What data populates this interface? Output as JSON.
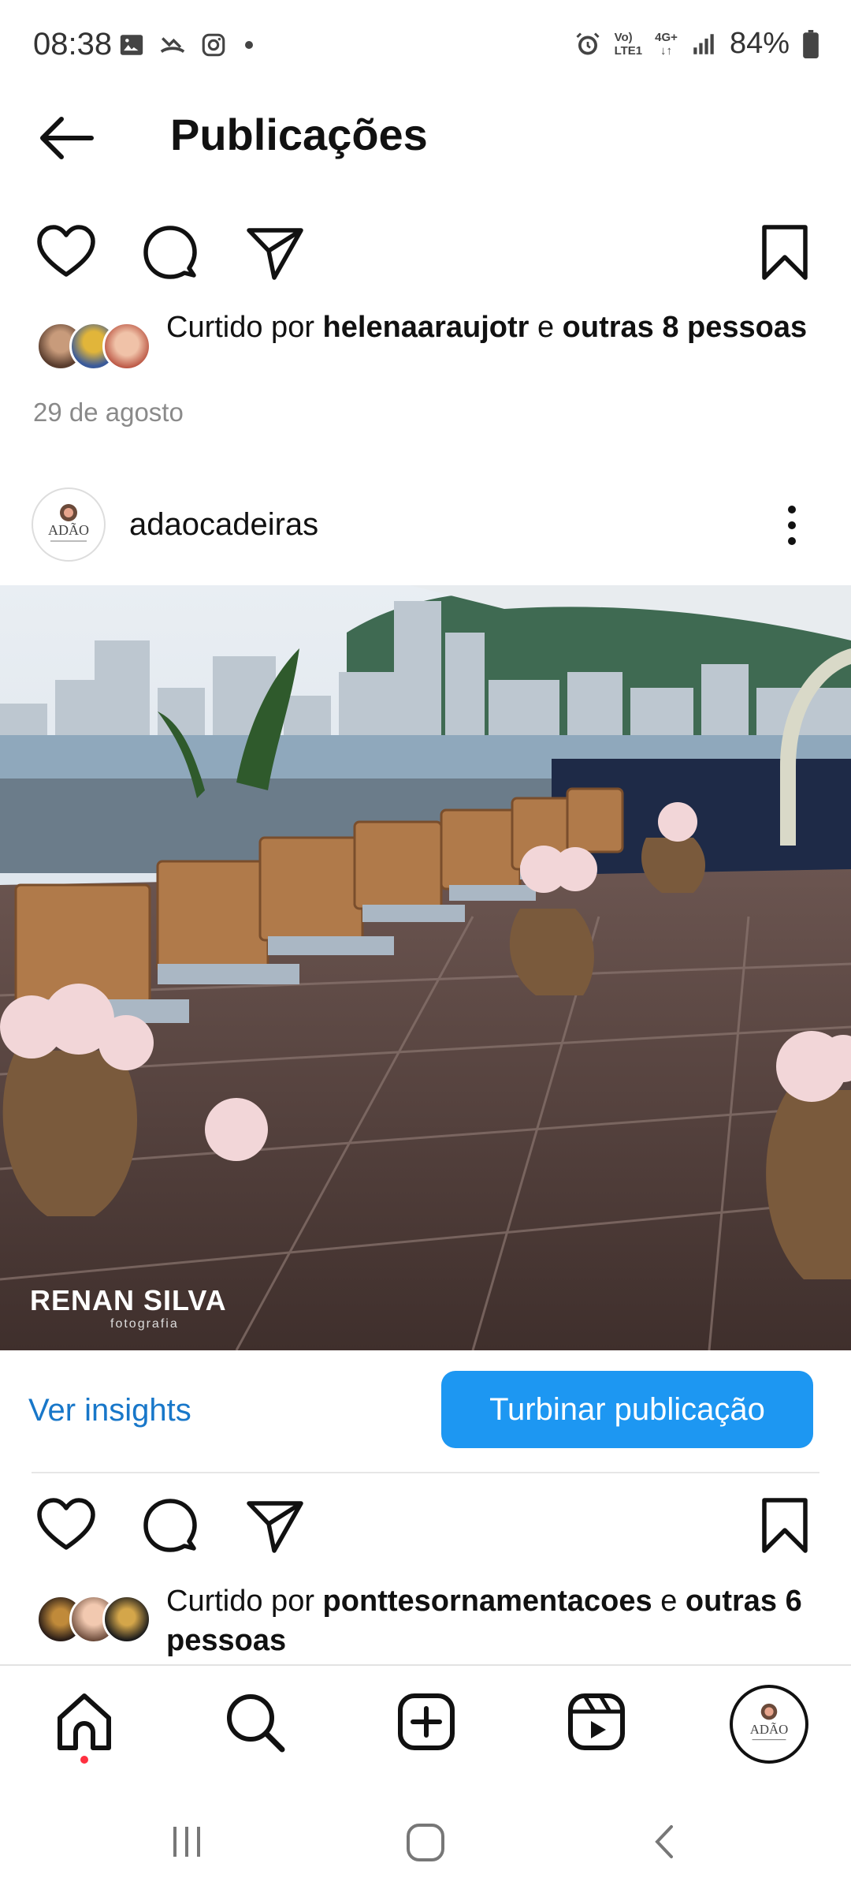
{
  "status_bar": {
    "time": "08:38",
    "battery": "84%",
    "network_top": "Vo)",
    "network_bottom": "LTE1",
    "network2_top": "4G+"
  },
  "header": {
    "title": "Publicações"
  },
  "post1": {
    "liked_prefix": "Curtido por ",
    "liked_user": "helenaaraujotr",
    "liked_mid": " e ",
    "liked_rest": "outras 8 pessoas",
    "date": "29 de agosto"
  },
  "post2": {
    "username": "adaocadeiras",
    "logo_text": "ADÃO",
    "watermark": "RENAN SILVA",
    "watermark_sub": "fotografia",
    "insights_label": "Ver insights",
    "boost_label": "Turbinar publicação",
    "liked_prefix": "Curtido por ",
    "liked_user": "ponttesornamentacoes",
    "liked_mid": " e ",
    "liked_rest": "outras 6 pessoas"
  },
  "nav": {
    "items": [
      "home-icon",
      "search-icon",
      "create-icon",
      "reels-icon",
      "profile-avatar"
    ],
    "profile_logo_text": "ADÃO"
  },
  "colors": {
    "accent": "#1d97f2",
    "link": "#1877c9",
    "notification": "#ff3040"
  }
}
